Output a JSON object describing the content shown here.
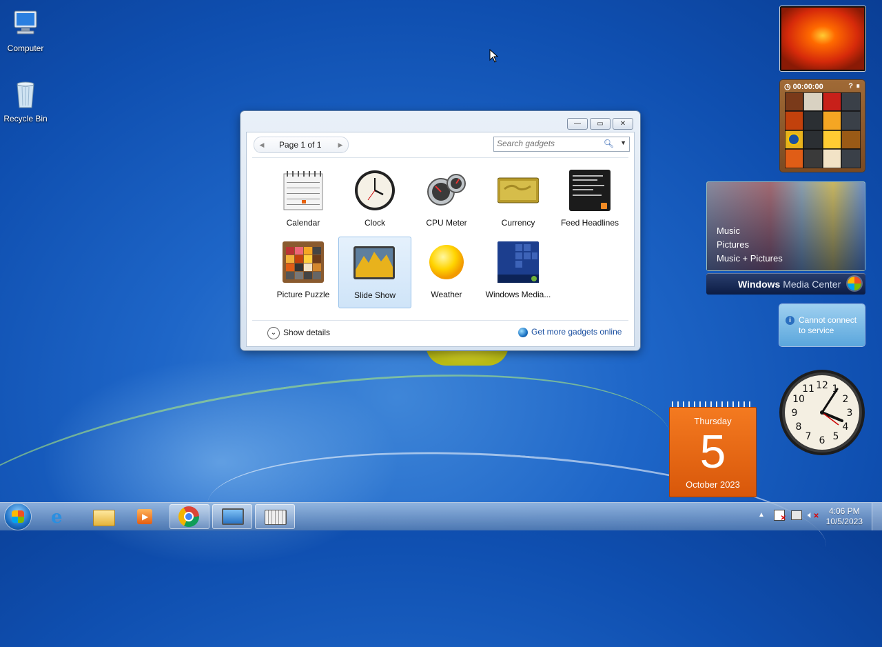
{
  "desktop": {
    "icons": [
      {
        "label": "Computer"
      },
      {
        "label": "Recycle Bin"
      }
    ]
  },
  "gallery": {
    "window_controls": {
      "minimize": "—",
      "maximize": "▭",
      "close": "✕"
    },
    "pager": {
      "label": "Page 1 of 1"
    },
    "search": {
      "placeholder": "Search gadgets"
    },
    "gadgets": [
      {
        "label": "Calendar"
      },
      {
        "label": "Clock"
      },
      {
        "label": "CPU Meter"
      },
      {
        "label": "Currency"
      },
      {
        "label": "Feed Headlines"
      },
      {
        "label": "Picture Puzzle"
      },
      {
        "label": "Slide Show",
        "selected": true
      },
      {
        "label": "Weather"
      },
      {
        "label": "Windows Media..."
      }
    ],
    "show_details": "Show details",
    "get_more": "Get more gadgets online"
  },
  "sidebar": {
    "puzzle_timer": "00:00:00",
    "media_center": {
      "items": [
        "Music",
        "Pictures",
        "Music + Pictures"
      ],
      "brand_bold": "Windows",
      "brand_light": "Media Center"
    },
    "feed_message": "Cannot connect to service",
    "calendar": {
      "weekday": "Thursday",
      "day": "5",
      "month_year": "October 2023"
    }
  },
  "taskbar": {
    "clock_time": "4:06 PM",
    "clock_date": "10/5/2023"
  },
  "colors": {
    "calendar_orange": "#e8620e",
    "accent": "#1e66c8"
  }
}
